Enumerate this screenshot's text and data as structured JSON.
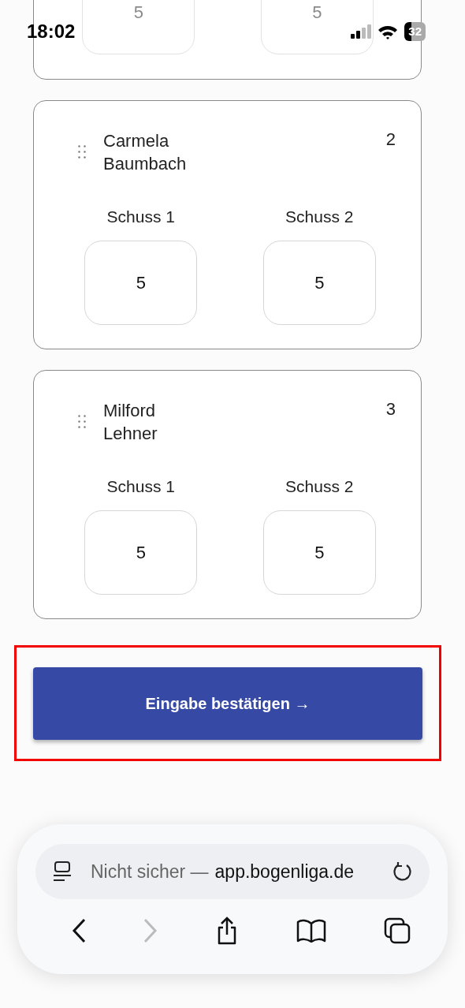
{
  "status_bar": {
    "time": "18:02",
    "battery": "32"
  },
  "partial_card": {
    "shots": [
      {
        "value": "5"
      },
      {
        "value": "5"
      }
    ]
  },
  "players": [
    {
      "name": "Carmela Baumbach",
      "number": "2",
      "shots": [
        {
          "label": "Schuss 1",
          "value": "5"
        },
        {
          "label": "Schuss 2",
          "value": "5"
        }
      ]
    },
    {
      "name": "Milford Lehner",
      "number": "3",
      "shots": [
        {
          "label": "Schuss 1",
          "value": "5"
        },
        {
          "label": "Schuss 2",
          "value": "5"
        }
      ]
    }
  ],
  "confirm_button": {
    "label": "Eingabe bestätigen →",
    "highlighted": true
  },
  "browser": {
    "security_label": "Nicht sicher —",
    "domain": "app.bogenliga.de",
    "forward_disabled": true
  }
}
